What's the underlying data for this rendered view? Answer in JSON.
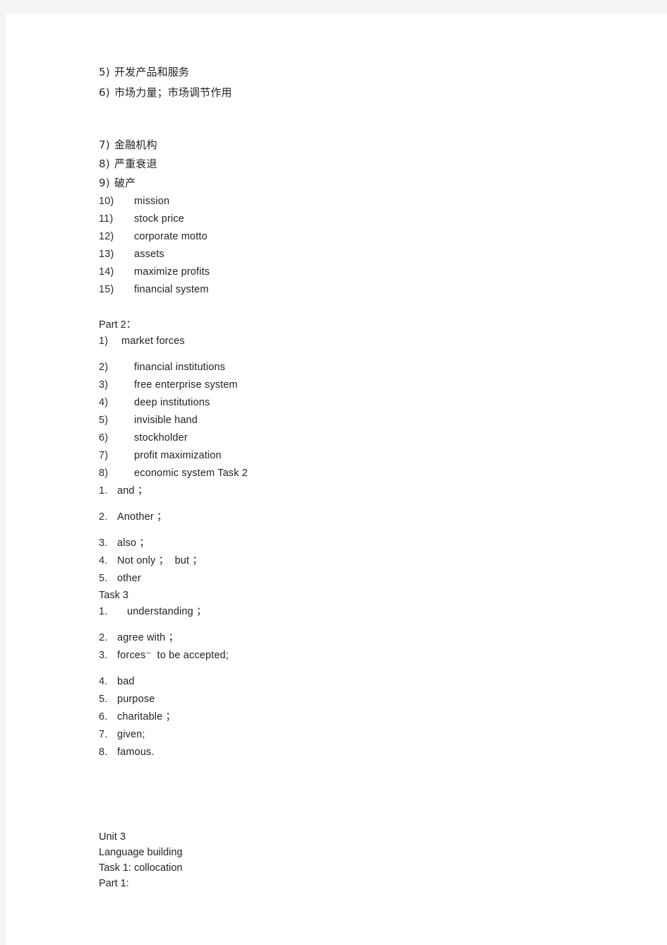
{
  "page": {
    "background_color": "#f4f4f4",
    "sheet_color": "#ffffff",
    "text_color": "#23231f"
  },
  "section_one": {
    "items": [
      {
        "marker": "5)",
        "text": "开发产品和服务",
        "cjk": true
      },
      {
        "marker": "6)",
        "text": "市场力量；市场调节作用",
        "cjk": true
      },
      {
        "marker": "7)",
        "text": "金融机构",
        "cjk": true
      },
      {
        "marker": "8)",
        "text": "严重衰退",
        "cjk": true
      },
      {
        "marker": "9)",
        "text": "破产",
        "cjk": true
      },
      {
        "marker": "10)",
        "text": "mission",
        "cjk": false
      },
      {
        "marker": "11)",
        "text": "stock price",
        "cjk": false
      },
      {
        "marker": "12)",
        "text": "corporate motto",
        "cjk": false
      },
      {
        "marker": "13)",
        "text": "assets",
        "cjk": false
      },
      {
        "marker": "14)",
        "text": "maximize profits",
        "cjk": false
      },
      {
        "marker": "15)",
        "text": "financial system",
        "cjk": false
      }
    ]
  },
  "part_two": {
    "heading": "Part 2：",
    "items": [
      {
        "marker": "1)",
        "text": "market forces"
      },
      {
        "marker": "2)",
        "text": "financial institutions"
      },
      {
        "marker": "3)",
        "text": "free enterprise system"
      },
      {
        "marker": "4)",
        "text": "deep institutions"
      },
      {
        "marker": "5)",
        "text": "invisible hand"
      },
      {
        "marker": "6)",
        "text": "stockholder"
      },
      {
        "marker": "7)",
        "text": "profit maximization"
      },
      {
        "marker": "8)",
        "text": "economic system Task 2"
      }
    ]
  },
  "task_two": {
    "items": [
      {
        "marker": "1.",
        "text": "and ；"
      },
      {
        "marker": "2.",
        "text": "Another ；"
      },
      {
        "marker": "3.",
        "text": "also ；"
      },
      {
        "marker": "4.",
        "text": "Not only ；  but ；"
      },
      {
        "marker": "5.",
        "text": "other"
      }
    ]
  },
  "task_three": {
    "heading": "Task 3",
    "items": [
      {
        "marker": "1.",
        "text": "understanding ；"
      },
      {
        "marker": "2.",
        "text": "agree with ；"
      },
      {
        "marker": "3.",
        "text": "forces⁻  to be accepted;"
      },
      {
        "marker": "4.",
        "text": "bad"
      },
      {
        "marker": "5.",
        "text": "purpose"
      },
      {
        "marker": "6.",
        "text": "charitable ；"
      },
      {
        "marker": "7.",
        "text": "given;"
      },
      {
        "marker": "8.",
        "text": "famous."
      }
    ]
  },
  "unit_three": {
    "lines": [
      "Unit 3",
      "Language building",
      "Task 1: collocation",
      "Part 1:"
    ]
  }
}
